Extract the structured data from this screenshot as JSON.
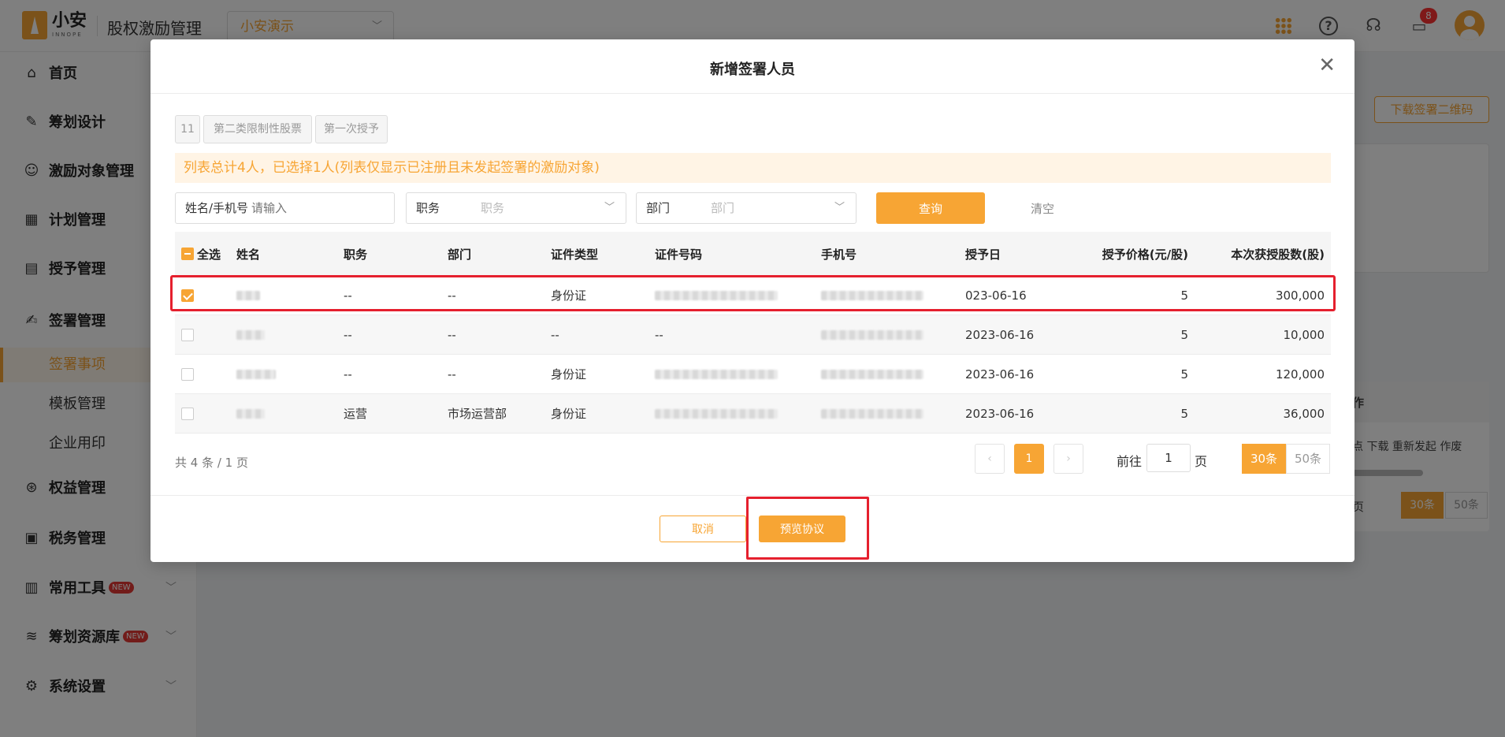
{
  "header": {
    "logo_cn": "小安",
    "logo_en": "INNOPE",
    "app_title": "股权激励管理",
    "company": "小安演示",
    "message_badge": "8"
  },
  "sidebar": {
    "items": [
      {
        "label": "首页",
        "icon": "home-icon"
      },
      {
        "label": "筹划设计",
        "icon": "edit-icon"
      },
      {
        "label": "激励对象管理",
        "icon": "users-icon"
      },
      {
        "label": "计划管理",
        "icon": "grid-icon"
      },
      {
        "label": "授予管理",
        "icon": "book-icon"
      },
      {
        "label": "签署管理",
        "icon": "sign-icon"
      },
      {
        "label": "权益管理",
        "icon": "badge-icon"
      },
      {
        "label": "税务管理",
        "icon": "tax-icon"
      },
      {
        "label": "常用工具",
        "icon": "toolbox-icon",
        "badge": "NEW"
      },
      {
        "label": "筹划资源库",
        "icon": "layers-icon",
        "badge": "NEW"
      },
      {
        "label": "系统设置",
        "icon": "settings-icon"
      }
    ],
    "sub_items": [
      {
        "label": "签署事项"
      },
      {
        "label": "模板管理"
      },
      {
        "label": "企业用印"
      }
    ]
  },
  "background": {
    "download_qr": "下载签署二维码",
    "col_label": "作",
    "ops_text": "点 下载 重新发起 作废",
    "page_suffix": "页",
    "size30": "30条",
    "size50": "50条"
  },
  "modal": {
    "title": "新增签署人员",
    "tags": [
      "11",
      "第二类限制性股票",
      "第一次授予"
    ],
    "notice": "列表总计4人，已选择1人(列表仅显示已注册且未发起签署的激励对象)",
    "filters": {
      "name_label": "姓名/手机号",
      "name_placeholder": "请输入",
      "position_label": "职务",
      "position_placeholder": "职务",
      "dept_label": "部门",
      "dept_placeholder": "部门",
      "query": "查询",
      "clear": "清空"
    },
    "table": {
      "select_all": "全选",
      "headers": [
        "姓名",
        "职务",
        "部门",
        "证件类型",
        "证件号码",
        "手机号",
        "授予日",
        "授予价格(元/股)",
        "本次获授股数(股)"
      ],
      "rows": [
        {
          "position": "--",
          "dept": "--",
          "id_type": "身份证",
          "grant_date": "023-06-16",
          "price": "5",
          "shares": "300,000"
        },
        {
          "position": "--",
          "dept": "--",
          "id_type": "--",
          "id_no": "--",
          "grant_date": "2023-06-16",
          "price": "5",
          "shares": "10,000"
        },
        {
          "position": "--",
          "dept": "--",
          "id_type": "身份证",
          "grant_date": "2023-06-16",
          "price": "5",
          "shares": "120,000"
        },
        {
          "position": "运营",
          "dept": "市场运营部",
          "id_type": "身份证",
          "grant_date": "2023-06-16",
          "price": "5",
          "shares": "36,000"
        }
      ]
    },
    "pagination": {
      "total": "共 4 条 / 1 页",
      "current": "1",
      "goto": "前往",
      "page_input": "1",
      "page_suffix": "页",
      "size30": "30条",
      "size50": "50条"
    },
    "footer": {
      "cancel": "取消",
      "preview": "预览协议"
    }
  }
}
